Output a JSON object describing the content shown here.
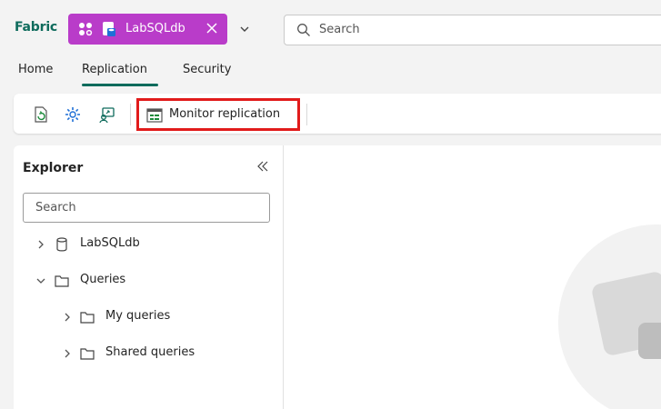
{
  "app": {
    "brand": "Fabric"
  },
  "item_tab": {
    "name": "LabSQLdb"
  },
  "search": {
    "placeholder": "Search"
  },
  "tabs": [
    {
      "label": "Home"
    },
    {
      "label": "Replication",
      "active": true
    },
    {
      "label": "Security"
    }
  ],
  "ribbon": {
    "icons": [
      "refresh-icon",
      "settings-gear-icon",
      "replication-icon"
    ],
    "monitor_label": "Monitor replication"
  },
  "explorer": {
    "title": "Explorer",
    "search_placeholder": "Search",
    "tree": [
      {
        "label": "LabSQLdb",
        "icon": "database-icon",
        "expanded": false
      },
      {
        "label": "Queries",
        "icon": "folder-icon",
        "expanded": true
      },
      {
        "label": "My queries",
        "icon": "folder-icon",
        "expanded": false
      },
      {
        "label": "Shared queries",
        "icon": "folder-icon",
        "expanded": false
      }
    ]
  },
  "colors": {
    "accent": "#0e6b5c",
    "pill": "#b93cc9",
    "highlight": "#e11b1b"
  }
}
